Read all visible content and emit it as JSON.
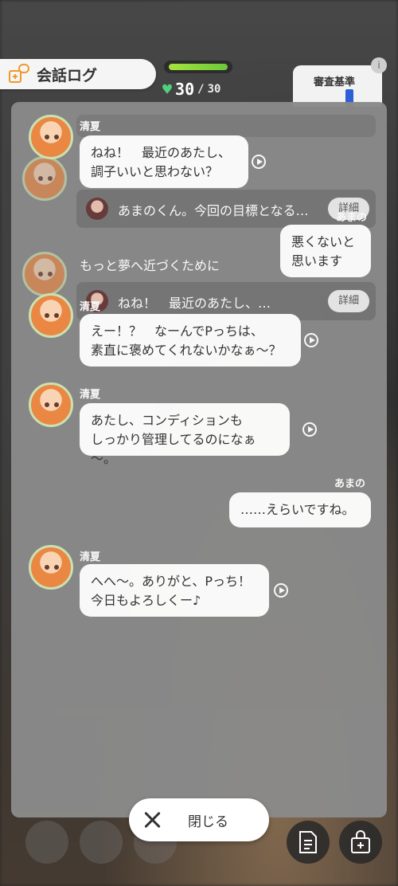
{
  "header": {
    "log_title": "会話ログ",
    "hp_current": "30",
    "hp_max": "30",
    "criteria_label": "審査基準"
  },
  "messages": [
    {
      "speaker": "清夏",
      "text": "ねね！　最近のあたし、\n調子いいと思わない？"
    },
    {
      "choice": "あまのくん。今回の目標となる…",
      "detail": "詳細"
    },
    {
      "speaker": "あまの",
      "text": "悪くないと\n思います"
    },
    {
      "text": "もっと夢へ近づくために"
    },
    {
      "choice": "ねね！　最近のあたし、…",
      "detail": "詳細",
      "speaker": "清夏"
    },
    {
      "text": "えー！？　なーんでPっちは、\n素直に褒めてくれないかなぁ～？"
    },
    {
      "speaker": "清夏",
      "text": "あたし、コンディションも\nしっかり管理してるのになぁ～。"
    },
    {
      "speaker": "あまの",
      "text": "……えらいですね。"
    },
    {
      "speaker": "清夏",
      "text": "へへ～。ありがと、Pっち！\n今日もよろしくー♪"
    }
  ],
  "footer": {
    "close_label": "閉じる"
  },
  "colors": {
    "accent_hp": "#6cc83a",
    "criteria_bar": "#2f5fd7"
  }
}
